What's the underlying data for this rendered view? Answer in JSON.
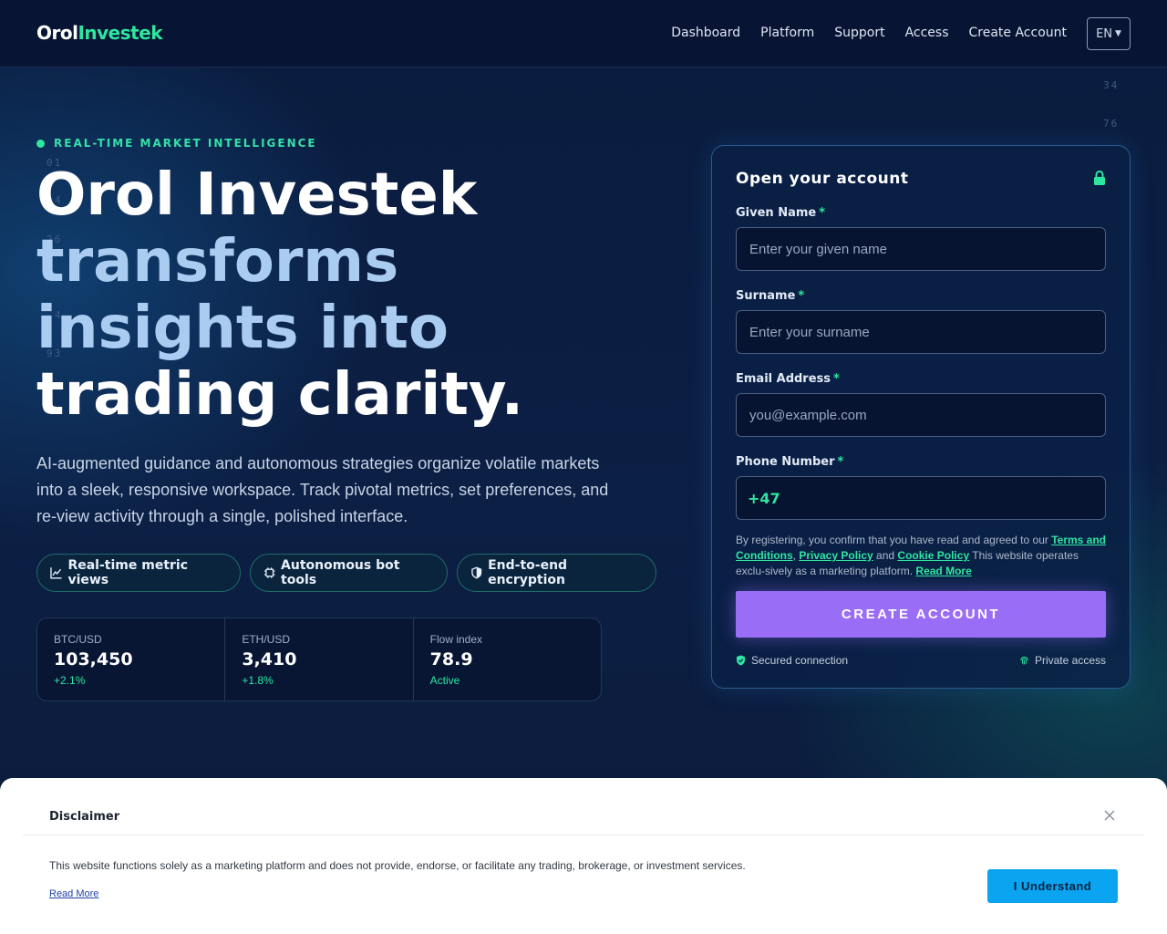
{
  "header": {
    "logo_part1": "Orol",
    "logo_part2": "Investek",
    "nav": [
      "Dashboard",
      "Platform",
      "Support",
      "Access",
      "Create Account"
    ],
    "language": "EN"
  },
  "background_numbers": [
    "34",
    "76",
    "01",
    "4",
    "26",
    "4",
    "93"
  ],
  "hero": {
    "eyebrow": "REAL-TIME MARKET INTELLIGENCE",
    "title_line1": "Orol Investek",
    "title_line2": "transforms",
    "title_line3": "insights into",
    "title_line4": "trading clarity.",
    "lead": "AI-augmented guidance and autonomous strategies organize volatile markets into a sleek, responsive workspace. Track pivotal metrics, set preferences, and re-view activity through a single, polished interface.",
    "pills": [
      "Real-time metric views",
      "Autonomous bot tools",
      "End-to-end encryption"
    ],
    "stats": [
      {
        "label": "BTC/USD",
        "value": "103,450",
        "delta": "+2.1%"
      },
      {
        "label": "ETH/USD",
        "value": "3,410",
        "delta": "+1.8%"
      },
      {
        "label": "Flow index",
        "value": "78.9",
        "delta": "Active"
      }
    ]
  },
  "form": {
    "title": "Open your account",
    "given_name_label": "Given Name",
    "given_name_placeholder": "Enter your given name",
    "surname_label": "Surname",
    "surname_placeholder": "Enter your surname",
    "email_label": "Email Address",
    "email_placeholder": "you@example.com",
    "phone_label": "Phone Number",
    "phone_code": "+47",
    "required_mark": "*",
    "consent_1": "By registering, you confirm that you have read and agreed to our ",
    "terms_link": "Terms and Conditions",
    "consent_2": ", ",
    "privacy_link": "Privacy Policy",
    "consent_3": " and ",
    "cookie_link": "Cookie Policy",
    "consent_4": " This website operates exclu-sively as a marketing platform. ",
    "read_more_link": "Read More",
    "submit": "CREATE ACCOUNT",
    "secured": "Secured connection",
    "private": "Private access"
  },
  "disclaimer": {
    "title": "Disclaimer",
    "text": "This website functions solely as a marketing platform and does not provide, endorse, or facilitate any trading, brokerage, or investment services.",
    "read_more": "Read More",
    "button": "I Understand"
  },
  "colors": {
    "accent_green": "#2ee6a0",
    "cta_purple": "#9a6df7",
    "understand_blue": "#0aa4f0",
    "background_navy": "#0b1a3a"
  }
}
